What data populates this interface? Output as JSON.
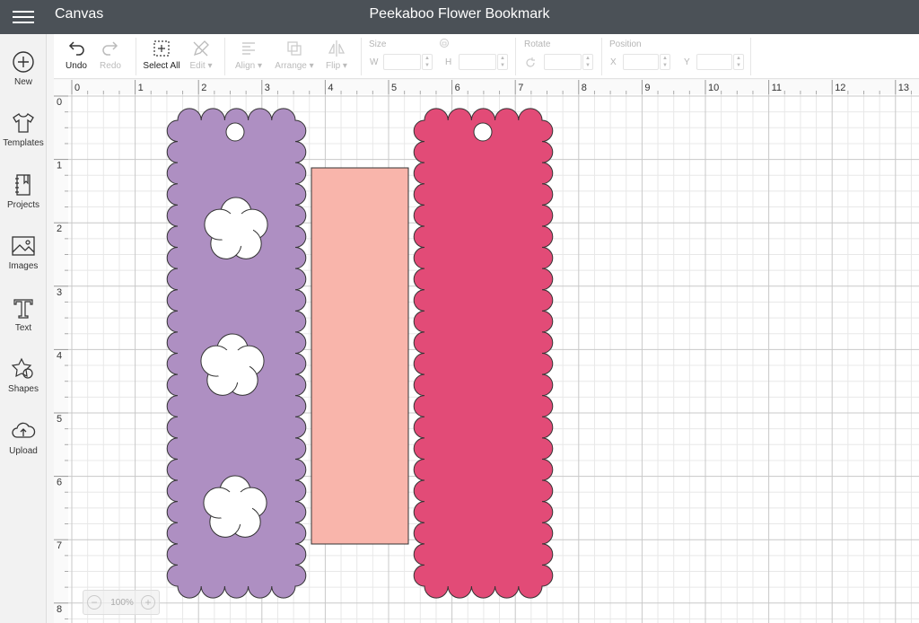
{
  "topbar": {
    "app_name": "Canvas",
    "title": "Peekaboo Flower Bookmark"
  },
  "leftnav": {
    "items": [
      {
        "label": "New",
        "icon": "plus-circle-icon"
      },
      {
        "label": "Templates",
        "icon": "tshirt-icon"
      },
      {
        "label": "Projects",
        "icon": "notebook-icon"
      },
      {
        "label": "Images",
        "icon": "image-icon"
      },
      {
        "label": "Text",
        "icon": "text-t-icon"
      },
      {
        "label": "Shapes",
        "icon": "shapes-icon"
      },
      {
        "label": "Upload",
        "icon": "cloud-upload-icon"
      }
    ]
  },
  "toolbar": {
    "undo": "Undo",
    "redo": "Redo",
    "select_all": "Select All",
    "edit": "Edit",
    "align": "Align",
    "arrange": "Arrange",
    "flip": "Flip",
    "size": {
      "label": "Size",
      "w": "W",
      "h": "H"
    },
    "rotate": {
      "label": "Rotate"
    },
    "position": {
      "label": "Position",
      "x": "X",
      "y": "Y"
    }
  },
  "ruler": {
    "x_ticks": [
      "0",
      "1",
      "2",
      "3",
      "4",
      "5",
      "6",
      "7",
      "8",
      "9",
      "10",
      "11",
      "12",
      "13"
    ],
    "y_ticks": [
      "0",
      "1",
      "2",
      "3",
      "4",
      "5",
      "6",
      "7",
      "8"
    ]
  },
  "objects": [
    {
      "name": "purple-scalloped-bookmark",
      "color": "#ae8fc2"
    },
    {
      "name": "peach-rectangle",
      "color": "#f9b5ab"
    },
    {
      "name": "pink-scalloped-bookmark",
      "color": "#e24b77"
    }
  ],
  "zoom": {
    "level": "100%",
    "minus": "−",
    "plus": "+"
  }
}
